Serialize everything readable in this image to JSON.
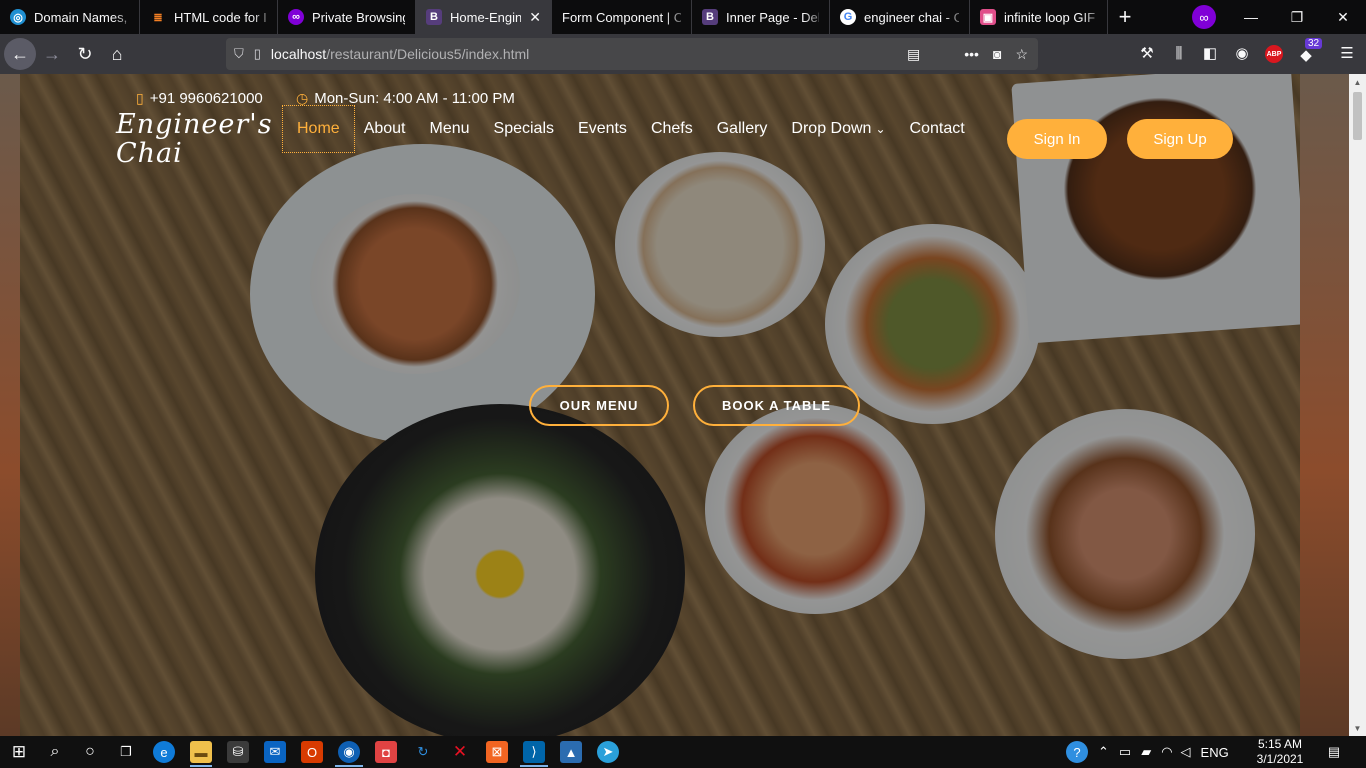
{
  "browser": {
    "tabs": [
      {
        "label": "Domain Names, W",
        "icon": "domain-icon",
        "color": "#1f8fd1",
        "active": false
      },
      {
        "label": "HTML code for IN",
        "icon": "stackoverflow-icon",
        "color": "#f48024",
        "active": false
      },
      {
        "label": "Private Browsing",
        "icon": "private-browsing-icon",
        "color": "#8000d7",
        "active": false
      },
      {
        "label": "Home-Engineer",
        "icon": "bootstrap-icon",
        "color": "#563d7c",
        "active": true
      },
      {
        "label": "Form Component | Cr",
        "icon": "blank-page-icon",
        "color": "#38383d",
        "active": false
      },
      {
        "label": "Inner Page - Delici",
        "icon": "bootstrap-icon",
        "color": "#563d7c",
        "active": false
      },
      {
        "label": "engineer chai - Go",
        "icon": "google-icon",
        "color": "#ffffff",
        "active": false
      },
      {
        "label": "infinite loop GIF -",
        "icon": "page-icon",
        "color": "#e04f8a",
        "active": false
      }
    ],
    "new_tab_symbol": "+",
    "url_host": "localhost",
    "url_path": "/restaurant/Delicious5/index.html",
    "extension_badge": "32",
    "abp_label": "ABP"
  },
  "site": {
    "phone": "+91 9960621000",
    "hours": "Mon-Sun: 4:00 AM - 11:00 PM",
    "logo_line1": "Engineer's",
    "logo_line2": "Chai",
    "menu": [
      "Home",
      "About",
      "Menu",
      "Specials",
      "Events",
      "Chefs",
      "Gallery",
      "Drop Down",
      "Contact"
    ],
    "active_menu": "Home",
    "sign_in": "Sign In",
    "sign_up": "Sign Up",
    "cta_menu": "OUR MENU",
    "cta_table": "BOOK A TABLE",
    "accent_color": "#ffb03b"
  },
  "taskbar": {
    "language": "ENG",
    "time": "5:15 AM",
    "date": "3/1/2021"
  }
}
